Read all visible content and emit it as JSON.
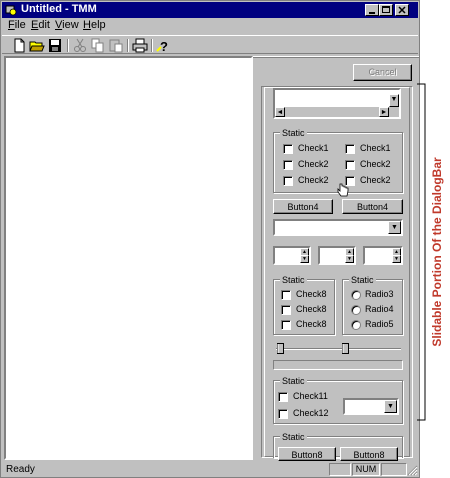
{
  "window": {
    "title": "Untitled - TMM"
  },
  "menu": [
    {
      "underline": "F",
      "rest": "ile"
    },
    {
      "underline": "E",
      "rest": "dit"
    },
    {
      "underline": "V",
      "rest": "iew"
    },
    {
      "underline": "H",
      "rest": "elp"
    }
  ],
  "toolbar_icons": [
    "new-icon",
    "open-icon",
    "save-icon",
    "cut-icon",
    "copy-icon",
    "paste-icon",
    "print-icon",
    "help-icon"
  ],
  "dialogbar": {
    "cancel_label": "Cancel",
    "group1": {
      "label": "Static",
      "checks_left": [
        "Check1",
        "Check2",
        "Check2"
      ],
      "checks_right": [
        "Check1",
        "Check2",
        "Check2"
      ]
    },
    "button4a": "Button4",
    "button4b": "Button4",
    "group2": {
      "label": "Static",
      "checks": [
        "Check8",
        "Check8",
        "Check8"
      ]
    },
    "group3": {
      "label": "Static",
      "radios": [
        "Radio3",
        "Radio4",
        "Radio5"
      ]
    },
    "group4": {
      "label": "Static",
      "checks": [
        "Check11",
        "Check12"
      ]
    },
    "group5": {
      "label": "Static",
      "buttons": [
        "Button8",
        "Button8"
      ]
    }
  },
  "status": {
    "text": "Ready",
    "num": "NUM"
  },
  "annotation": {
    "text": "Slidable Portion Of the DialogBar",
    "color": "#c0392b"
  }
}
